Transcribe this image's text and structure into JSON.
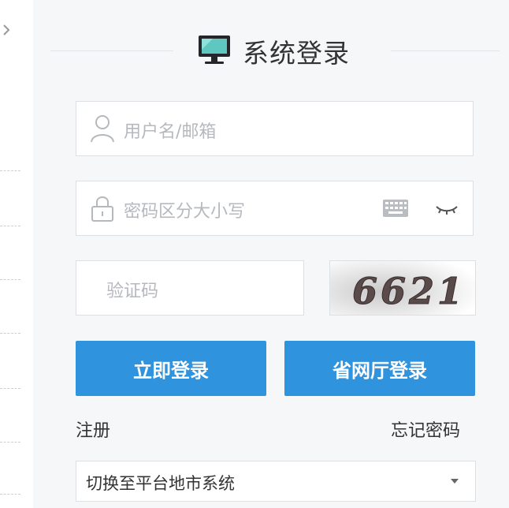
{
  "header": {
    "title": "系统登录",
    "icon": "monitor-icon"
  },
  "form": {
    "username": {
      "placeholder": "用户名/邮箱",
      "icon": "user-icon"
    },
    "password": {
      "placeholder": "密码区分大小写",
      "icon": "lock-icon",
      "keyboard_icon": "keyboard-icon",
      "toggle_icon": "eye-closed-icon"
    },
    "captcha": {
      "placeholder": "验证码",
      "image_text": "6621"
    }
  },
  "buttons": {
    "login": "立即登录",
    "hall_login": "省网厅登录"
  },
  "links": {
    "register": "注册",
    "forgot": "忘记密码"
  },
  "system_select": {
    "selected": "切换至平台地市系统"
  },
  "colors": {
    "primary": "#2f93de",
    "panel_bg": "#f6f7f9",
    "border": "#dcdfe3",
    "placeholder": "#b5b8bd",
    "text": "#333333"
  }
}
